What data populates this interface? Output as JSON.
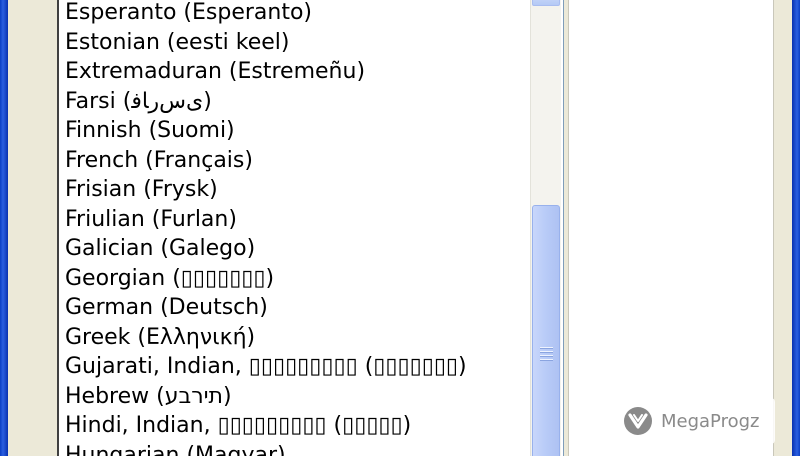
{
  "language_list": {
    "items": [
      "Esperanto (Esperanto)",
      "Estonian (eesti keel)",
      "Extremaduran (Estremeñu)",
      "Farsi (ﻯﺱﺭﺎﻓ)",
      "Finnish (Suomi)",
      "French (Français)",
      "Frisian (Frysk)",
      "Friulian (Furlan)",
      "Galician (Galego)",
      "Georgian (▯▯▯▯▯▯▯)",
      "German (Deutsch)",
      "Greek (Ελληνική)",
      "Gujarati, Indian, ▯▯▯▯▯▯▯▯▯ (▯▯▯▯▯▯▯)",
      "Hebrew (תירבע)",
      "Hindi, Indian, ▯▯▯▯▯▯▯▯▯ (▯▯▯▯▯)",
      "Hungarian (Magyar)"
    ]
  },
  "scrollbar": {
    "thumb_position_fraction": 0.45
  },
  "watermark": {
    "text": "MegaProgz"
  },
  "colors": {
    "window_frame": "#0a3ec4",
    "dialog_background": "#ece9d8",
    "scroll_thumb": "#b8cbf7"
  }
}
